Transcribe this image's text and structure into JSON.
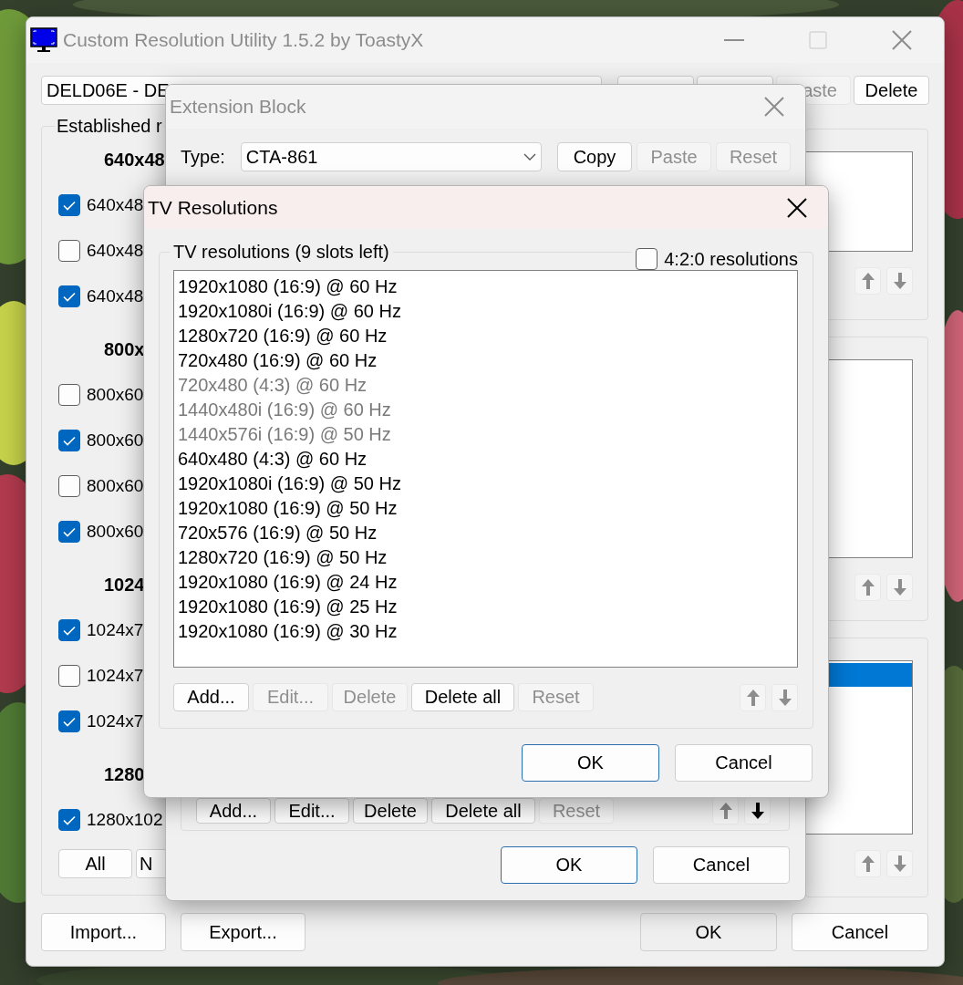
{
  "main_window": {
    "title": "Custom Resolution Utility 1.5.2 by ToastyX",
    "active": false,
    "display_select": "DELD06E - DE",
    "top_buttons": [
      {
        "kind": "hidden"
      },
      {
        "kind": "hidden"
      },
      {
        "kind": "clipped",
        "label": "aste",
        "disabled": true
      },
      {
        "kind": "full",
        "label": "Delete",
        "disabled": false
      }
    ],
    "established": {
      "label": "Established r",
      "groups": [
        {
          "header": "640x48",
          "items": [
            {
              "label": "640x48",
              "checked": true
            },
            {
              "label": "640x48",
              "checked": false
            },
            {
              "label": "640x48",
              "checked": true
            }
          ]
        },
        {
          "header": "800x",
          "items": [
            {
              "label": "800x60",
              "checked": false
            },
            {
              "label": "800x60",
              "checked": true
            },
            {
              "label": "800x60",
              "checked": false
            },
            {
              "label": "800x60",
              "checked": true
            }
          ]
        },
        {
          "header": "1024",
          "items": [
            {
              "label": "1024x7",
              "checked": true
            },
            {
              "label": "1024x7",
              "checked": false
            },
            {
              "label": "1024x7",
              "checked": true
            }
          ]
        },
        {
          "header": "1280",
          "items": [
            {
              "label": "1280x102",
              "checked": true
            }
          ]
        }
      ],
      "buttons": [
        "All",
        "N"
      ]
    },
    "right_lists": [
      {
        "has_selection": false,
        "up_disabled": true,
        "down_disabled": true
      },
      {
        "has_selection": false,
        "up_disabled": true,
        "down_disabled": true
      },
      {
        "has_selection": true,
        "up_disabled": true,
        "down_disabled": true
      }
    ],
    "left_buttons": [
      "Import...",
      "Export..."
    ],
    "right_buttons": [
      {
        "label": "OK",
        "default": false
      },
      {
        "label": "Cancel",
        "default": false
      }
    ]
  },
  "extension_block": {
    "title": "Extension Block",
    "active": false,
    "type_label": "Type:",
    "type_value": "CTA-861",
    "buttons": [
      {
        "label": "Copy",
        "disabled": false
      },
      {
        "label": "Paste",
        "disabled": true
      },
      {
        "label": "Reset",
        "disabled": true
      }
    ],
    "list_buttons": [
      {
        "label": "Add...",
        "disabled": false
      },
      {
        "label": "Edit...",
        "disabled": false
      },
      {
        "label": "Delete",
        "disabled": false
      },
      {
        "label": "Delete all",
        "disabled": false
      },
      {
        "label": "Reset",
        "disabled": true
      }
    ],
    "arrows": {
      "up_disabled": true,
      "down_disabled": false
    },
    "footer_buttons": [
      {
        "label": "OK",
        "default": true
      },
      {
        "label": "Cancel",
        "default": false
      }
    ]
  },
  "tv_resolutions": {
    "title": "TV Resolutions",
    "active": true,
    "group_label": "TV resolutions (9 slots left)",
    "option": {
      "label": "4:2:0 resolutions",
      "checked": false
    },
    "items": [
      {
        "label": "1920x1080 (16:9) @ 60 Hz",
        "disabled": false
      },
      {
        "label": "1920x1080i (16:9) @ 60 Hz",
        "disabled": false
      },
      {
        "label": "1280x720 (16:9) @ 60 Hz",
        "disabled": false
      },
      {
        "label": "720x480 (16:9) @ 60 Hz",
        "disabled": false
      },
      {
        "label": "720x480 (4:3) @ 60 Hz",
        "disabled": true
      },
      {
        "label": "1440x480i (16:9) @ 60 Hz",
        "disabled": true
      },
      {
        "label": "1440x576i (16:9) @ 50 Hz",
        "disabled": true
      },
      {
        "label": "640x480 (4:3) @ 60 Hz",
        "disabled": false
      },
      {
        "label": "1920x1080i (16:9) @ 50 Hz",
        "disabled": false
      },
      {
        "label": "1920x1080 (16:9) @ 50 Hz",
        "disabled": false
      },
      {
        "label": "720x576 (16:9) @ 50 Hz",
        "disabled": false
      },
      {
        "label": "1280x720 (16:9) @ 50 Hz",
        "disabled": false
      },
      {
        "label": "1920x1080 (16:9) @ 24 Hz",
        "disabled": false
      },
      {
        "label": "1920x1080 (16:9) @ 25 Hz",
        "disabled": false
      },
      {
        "label": "1920x1080 (16:9) @ 30 Hz",
        "disabled": false
      }
    ],
    "buttons": [
      {
        "label": "Add...",
        "disabled": false
      },
      {
        "label": "Edit...",
        "disabled": true
      },
      {
        "label": "Delete",
        "disabled": true
      },
      {
        "label": "Delete all",
        "disabled": false
      },
      {
        "label": "Reset",
        "disabled": true
      }
    ],
    "arrows": {
      "up_disabled": true,
      "down_disabled": true
    },
    "footer_buttons": [
      {
        "label": "OK",
        "default": true
      },
      {
        "label": "Cancel",
        "default": false
      }
    ]
  }
}
